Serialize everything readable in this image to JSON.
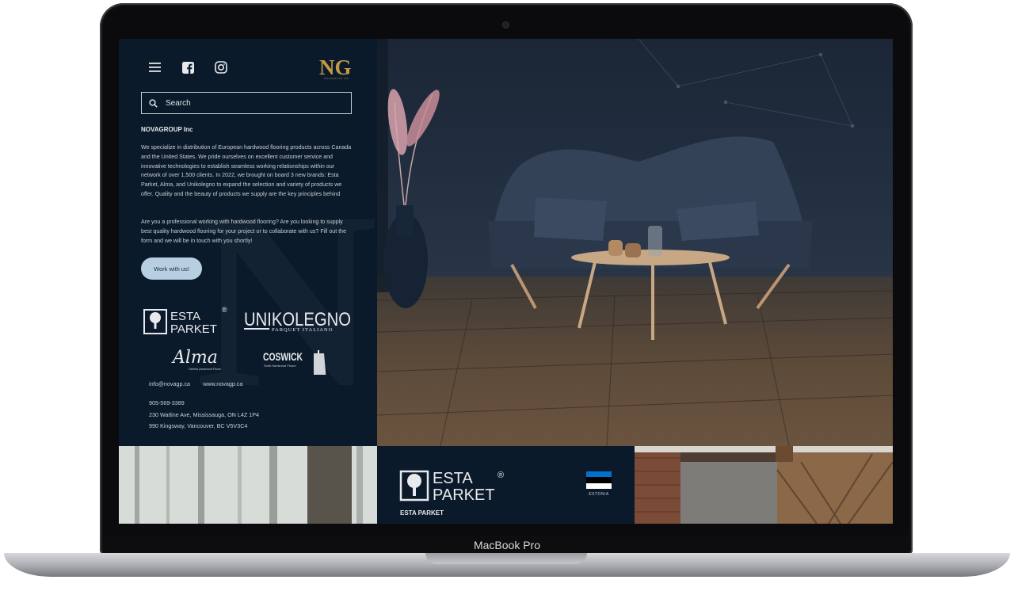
{
  "device": {
    "label": "MacBook Pro"
  },
  "header": {
    "logo_text": "NG",
    "logo_subtitle": "NOVAGROUP INC",
    "icons": [
      "menu-icon",
      "facebook-icon",
      "instagram-icon"
    ]
  },
  "search": {
    "placeholder": "Search"
  },
  "about": {
    "company": "NOVAGROUP Inc",
    "paragraph1": "We specialize in distribution of European hardwood flooring products across Canada and the United States. We pride ourselves on excellent customer service and innovative technologies to establish seamless working relationships within our network of over 1,500 clients. In 2022, we brought on board 3 new brands: Esta Parket, Alma, and Unikolegno to expand the selection and variety of products we offer. Quality and the beauty of products we supply are the key principles behind",
    "paragraph2": "Are you a professional working with hardwood flooring? Are you looking to supply best quality hardwood flooring for your project or to collaborate with us? Fill out the form and we will be in touch with you shortly!",
    "cta_label": "Work with us!"
  },
  "brands": {
    "esta_line1": "ESTA",
    "esta_line2": "PARKET",
    "registered": "®",
    "unikolegno": "UNIKOLEGNO",
    "unikolegno_sub": "PARQUET ITALIANO",
    "alma": "Alma",
    "alma_sub": "Fabrika' paramount Floors",
    "coswick": "COSWICK",
    "coswick_sub": "Solid Hardwood Floors"
  },
  "contact": {
    "email": "info@novagp.ca",
    "website": "www.novagp.ca",
    "phone": "905-569-3389",
    "address1": "230 Watline Ave, Mississauga, ON L4Z 1P4",
    "address2": "990 Kingsway, Vancouver, BC V5V3C4"
  },
  "tiles": {
    "brand_line1": "ESTA",
    "brand_line2": "PARKET",
    "registered": "®",
    "country": "ESTONIA",
    "name": "ESTA PARKET",
    "flag_colors": [
      "#0072ce",
      "#000000",
      "#ffffff"
    ]
  },
  "colors": {
    "panel": "#0b1a2b",
    "accent": "#b7cfe0",
    "gold": "#c29a45"
  }
}
